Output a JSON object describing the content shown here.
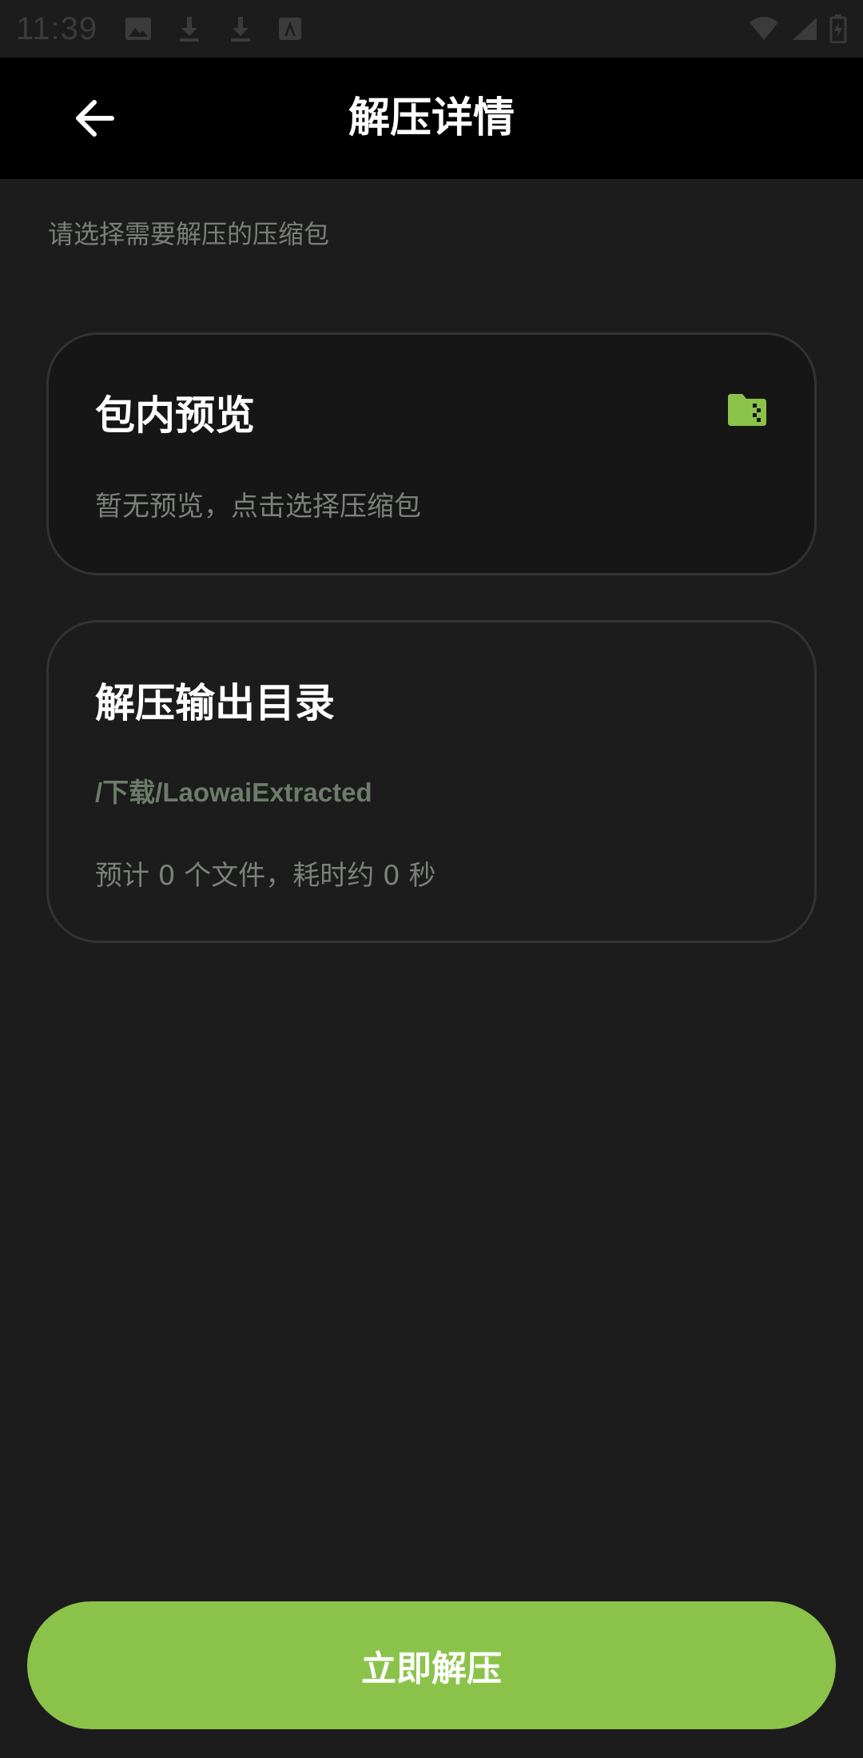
{
  "status_bar": {
    "time": "11:39",
    "icons": [
      "image-icon",
      "download-icon",
      "download-icon",
      "font-icon",
      "wifi-icon",
      "signal-icon",
      "battery-icon"
    ]
  },
  "app_bar": {
    "back_icon": "arrow-left-icon",
    "title": "解压详情"
  },
  "hint": "请选择需要解压的压缩包",
  "preview_card": {
    "title": "包内预览",
    "icon": "archive-folder-icon",
    "empty_text": "暂无预览，点击选择压缩包"
  },
  "output_card": {
    "title": "解压输出目录",
    "path": "/下载/LaowaiExtracted",
    "estimate": "预计 0 个文件，耗时约 0 秒"
  },
  "action": {
    "extract_label": "立即解压"
  },
  "colors": {
    "accent": "#8bc34a",
    "background": "#1c1c1c",
    "app_bar": "#000000",
    "path_text": "#6c7d69"
  }
}
